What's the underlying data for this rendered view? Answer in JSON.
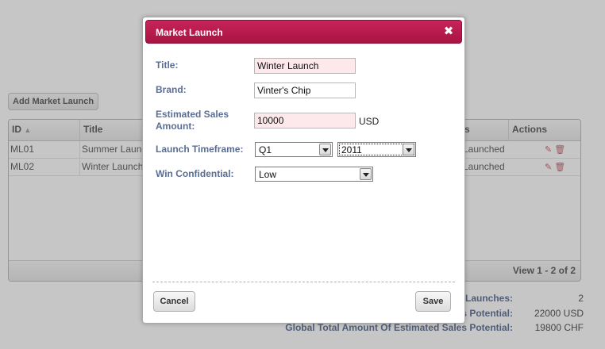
{
  "background": {
    "add_button": "Add Market Launch",
    "columns": [
      "ID",
      "Title",
      "s",
      "Actions"
    ],
    "rows": [
      {
        "id": "ML01",
        "title": "Summer Launch",
        "status": "Launched"
      },
      {
        "id": "ML02",
        "title": "Winter Launch",
        "status": "Launched"
      }
    ],
    "pager": "View 1 - 2 of 2",
    "stats": [
      {
        "label": "Launches:",
        "value": "2"
      },
      {
        "label": "s Potential:",
        "value": "22000 USD"
      },
      {
        "label": "Global Total Amount Of Estimated Sales Potential:",
        "value": "19800 CHF"
      }
    ]
  },
  "dialog": {
    "title": "Market Launch",
    "close_label": "✖",
    "fields": {
      "title": {
        "label": "Title:",
        "value": "Winter Launch"
      },
      "brand": {
        "label": "Brand:",
        "value": "Vinter's Chip"
      },
      "amount": {
        "label_line1": "Estimated Sales",
        "label_line2": "Amount:",
        "value": "10000",
        "unit": "USD"
      },
      "timeframe": {
        "label": "Launch Timeframe:",
        "quarter": "Q1",
        "year": "2011"
      },
      "confidential": {
        "label": "Win Confidential:",
        "value": "Low"
      }
    },
    "cancel_label": "Cancel",
    "save_label": "Save"
  },
  "colors": {
    "titlebar": "#b01a4a",
    "label": "#5a6e93",
    "required_field": "#fde8ec"
  }
}
